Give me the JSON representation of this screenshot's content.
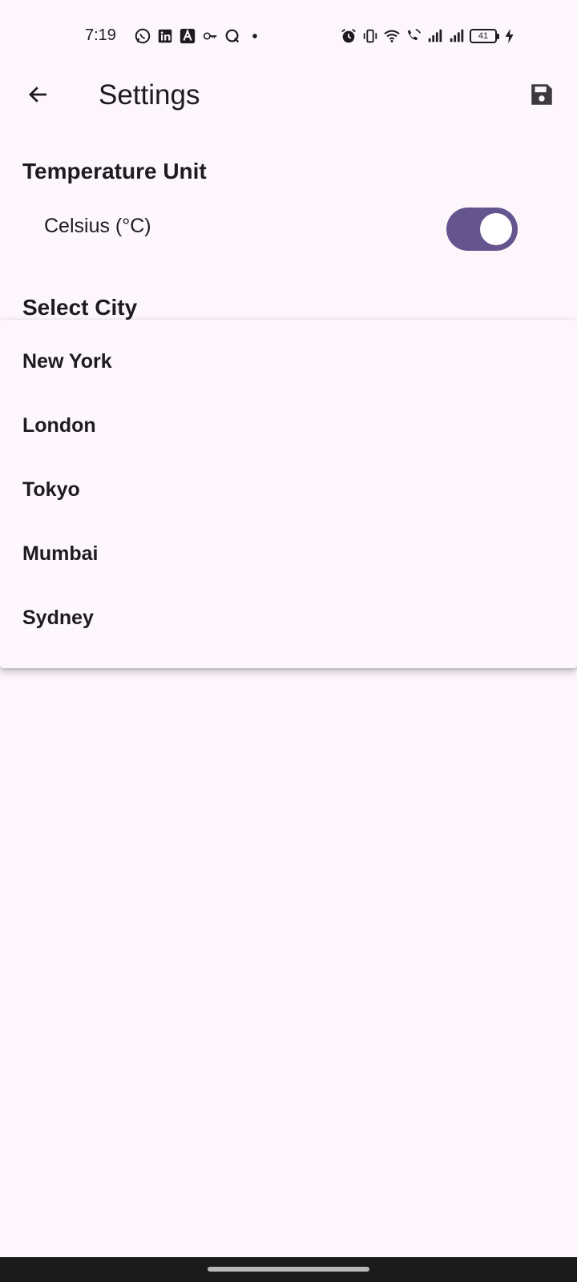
{
  "status_bar": {
    "time": "7:19",
    "notification_icons": [
      "whatsapp-icon",
      "linkedin-icon",
      "a-app-icon",
      "key-vpn-icon",
      "q-app-icon",
      "dot-icon"
    ],
    "system_icons": [
      "alarm-icon",
      "vibrate-icon",
      "wifi-icon",
      "wifi-call-icon",
      "signal-icon",
      "signal-icon"
    ],
    "battery_level": "41"
  },
  "app_bar": {
    "back_icon": "arrow-back-icon",
    "title": "Settings",
    "save_icon": "save-icon"
  },
  "settings": {
    "temperature_section_title": "Temperature Unit",
    "celsius_label": "Celsius (°C)",
    "celsius_enabled": true,
    "city_section_title": "Select City"
  },
  "city_dropdown": {
    "options": [
      "New York",
      "London",
      "Tokyo",
      "Mumbai",
      "Sydney"
    ]
  },
  "colors": {
    "background": "#fdf7fc",
    "accent": "#65558f",
    "text": "#1d1b20"
  }
}
